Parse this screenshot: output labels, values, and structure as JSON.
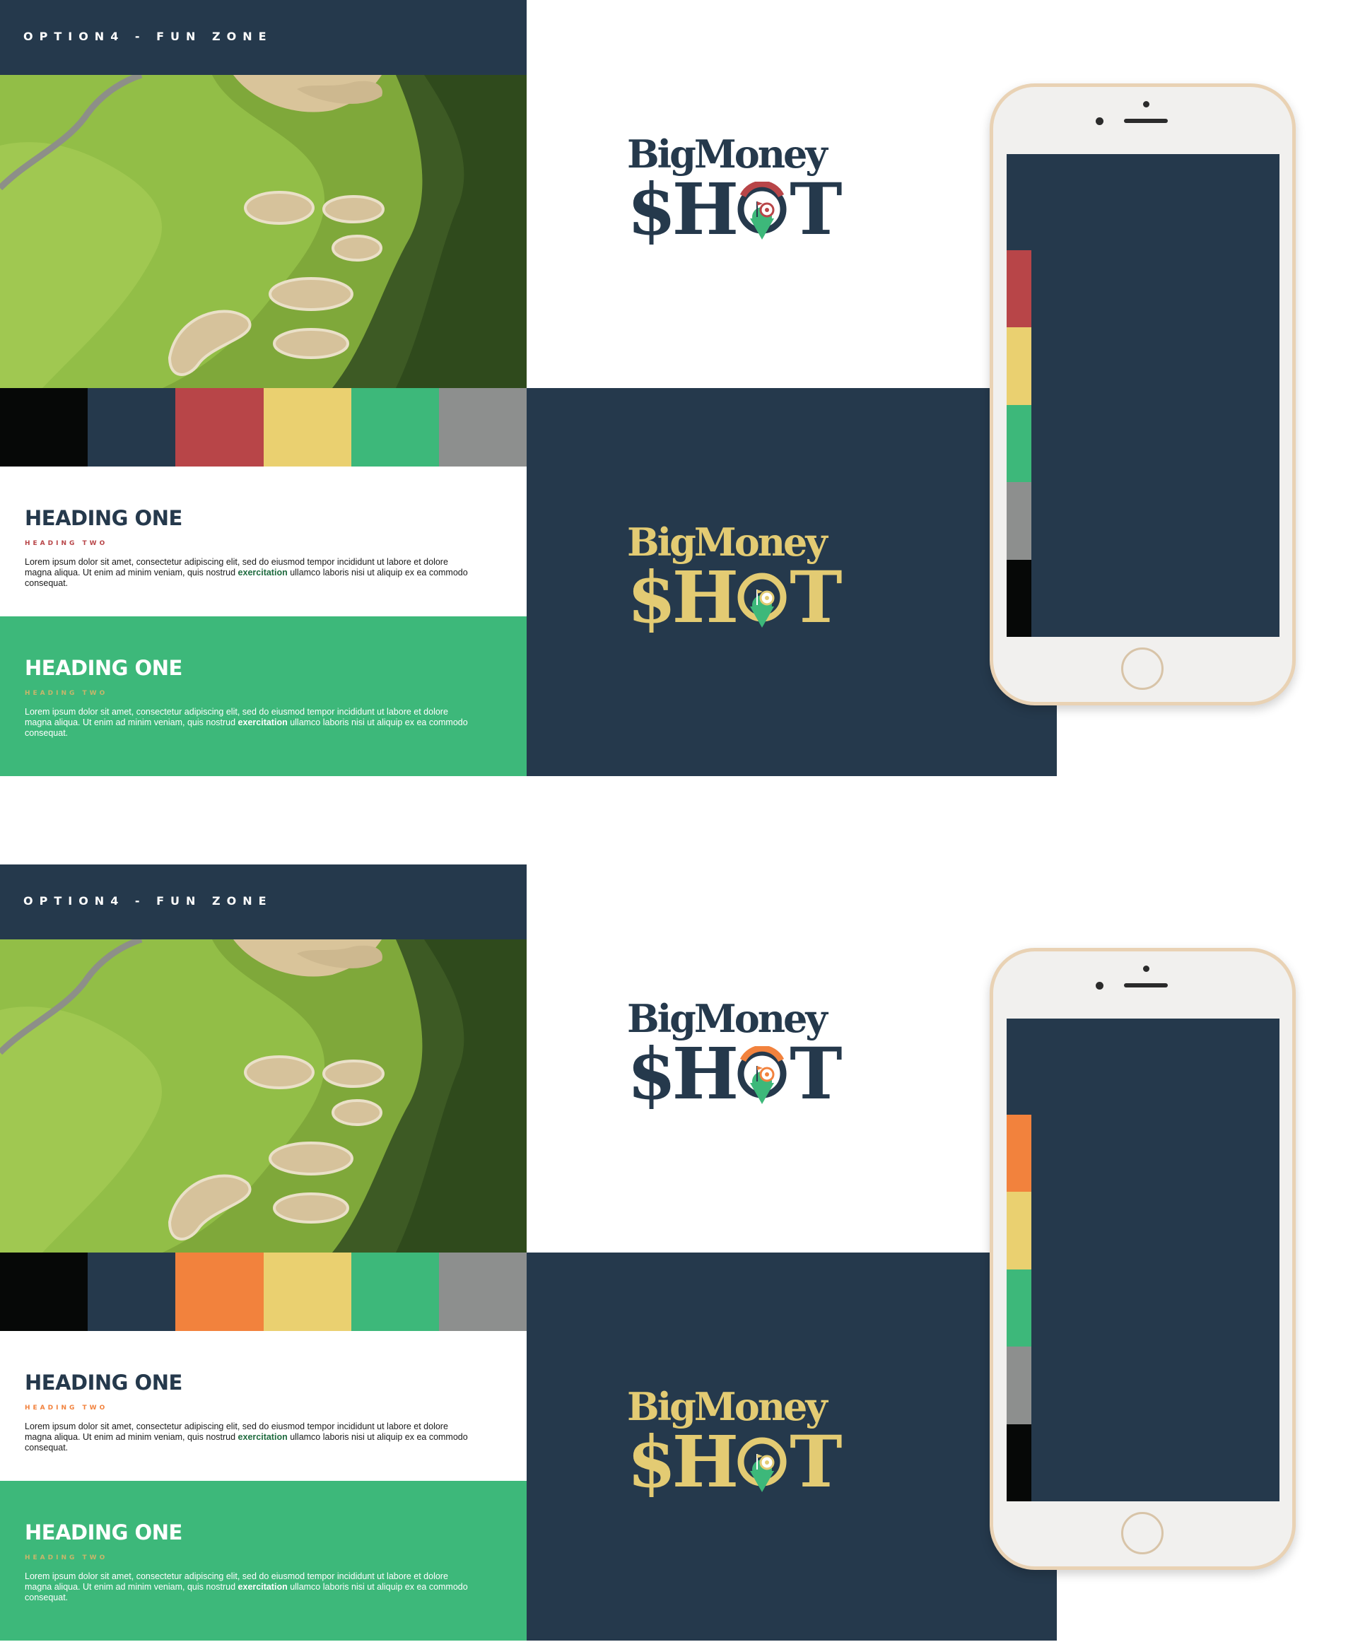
{
  "boards": [
    {
      "option_label": "OPTION4 - FUN ZONE",
      "swatches": [
        "#060807",
        "#25394c",
        "#b84548",
        "#ead070",
        "#3db87a",
        "#8d8f8e"
      ],
      "panel_light": {
        "heading_one": "HEADING ONE",
        "heading_two": "HEADING TWO",
        "heading_two_color": "#b84548",
        "body_before": "Lorem ipsum dolor sit amet, consectetur adipiscing elit, sed do eiusmod tempor incididunt ut labore et dolore magna aliqua. Ut enim ad minim veniam, quis nostrud ",
        "body_emphasis": "exercitation",
        "body_after": " ullamco laboris nisi ut aliquip ex ea commodo consequat."
      },
      "panel_green": {
        "heading_one": "HEADING ONE",
        "heading_two": "HEADING TWO",
        "body_before": "Lorem ipsum dolor sit amet, consectetur adipiscing elit, sed do eiusmod tempor incididunt ut labore et dolore magna aliqua. Ut enim ad minim veniam, quis nostrud ",
        "body_emphasis": "exercitation",
        "body_after": " ullamco laboris nisi ut aliquip ex ea commodo consequat."
      },
      "logo": {
        "line1": "BigMoney",
        "line2_left": "$H",
        "line2_right": "T",
        "accent": "#b84548"
      },
      "phone_strip": [
        "#b84548",
        "#ead070",
        "#3db87a",
        "#8d8f8e",
        "#060807"
      ]
    },
    {
      "option_label": "OPTION4 - FUN ZONE",
      "swatches": [
        "#060807",
        "#25394c",
        "#f2823d",
        "#ead070",
        "#3db87a",
        "#8d8f8e"
      ],
      "panel_light": {
        "heading_one": "HEADING ONE",
        "heading_two": "HEADING TWO",
        "heading_two_color": "#f2823d",
        "body_before": "Lorem ipsum dolor sit amet, consectetur adipiscing elit, sed do eiusmod tempor incididunt ut labore et dolore magna aliqua. Ut enim ad minim veniam, quis nostrud ",
        "body_emphasis": "exercitation",
        "body_after": " ullamco laboris nisi ut aliquip ex ea commodo consequat."
      },
      "panel_green": {
        "heading_one": "HEADING ONE",
        "heading_two": "HEADING TWO",
        "body_before": "Lorem ipsum dolor sit amet, consectetur adipiscing elit, sed do eiusmod tempor incididunt ut labore et dolore magna aliqua. Ut enim ad minim veniam, quis nostrud ",
        "body_emphasis": "exercitation",
        "body_after": " ullamco laboris nisi ut aliquip ex ea commodo consequat."
      },
      "logo": {
        "line1": "BigMoney",
        "line2_left": "$H",
        "line2_right": "T",
        "accent": "#f2823d"
      },
      "phone_strip": [
        "#f2823d",
        "#ead070",
        "#3db87a",
        "#8d8f8e",
        "#060807"
      ]
    }
  ],
  "colors": {
    "navy": "#25394c",
    "gold": "#e3cb73",
    "green": "#3db87a",
    "dark_green_text": "#1f6b3f"
  }
}
